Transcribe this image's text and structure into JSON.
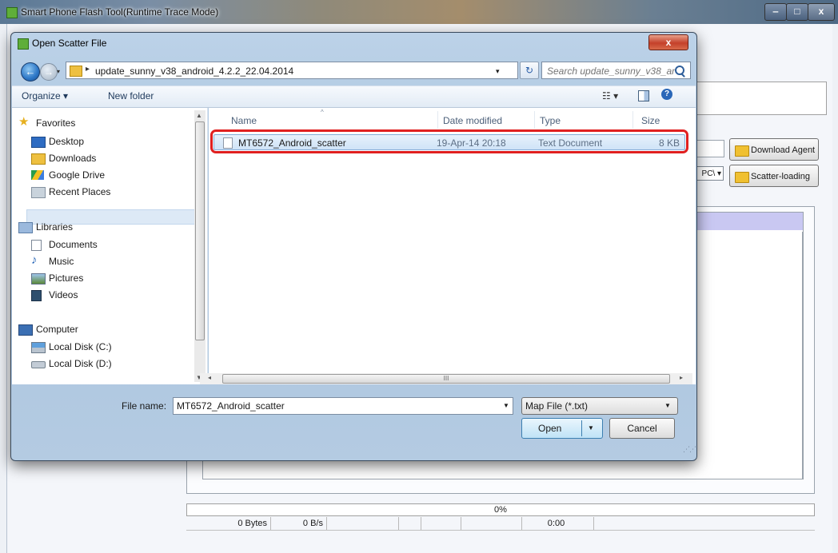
{
  "main_window": {
    "title": "Smart Phone Flash Tool(Runtime Trace Mode)",
    "controls": {
      "minimize": "‒",
      "maximize": "□",
      "close": "x"
    },
    "buttons": {
      "download_agent": "Download Agent",
      "scatter_loading": "Scatter-loading"
    },
    "scatter_combo_value": "PC\\ ▾",
    "status": {
      "percent": "0%",
      "bytes": "0 Bytes",
      "rate": "0 B/s",
      "time": "0:00"
    }
  },
  "dialog": {
    "title": "Open Scatter File",
    "close_label": "x",
    "address": {
      "path": "update_sunny_v38_android_4.2.2_22.04.2014",
      "separator": "▸",
      "dropdown": "▾"
    },
    "search": {
      "placeholder": "Search update_sunny_v38_an..."
    },
    "refresh_label": "↻",
    "toolbar": {
      "organize": "Organize ▾",
      "new_folder": "New folder",
      "views": "☷ ▾",
      "help": "?"
    },
    "nav": {
      "favorites": {
        "heading": "Favorites",
        "items": [
          "Desktop",
          "Downloads",
          "Google Drive",
          "Recent Places"
        ]
      },
      "libraries": {
        "heading": "Libraries",
        "items": [
          "Documents",
          "Music",
          "Pictures",
          "Videos"
        ]
      },
      "computer": {
        "heading": "Computer",
        "items": [
          "Local Disk (C:)",
          "Local Disk (D:)"
        ]
      }
    },
    "columns": {
      "name": "Name",
      "date": "Date modified",
      "type": "Type",
      "size": "Size"
    },
    "files": [
      {
        "name": "MT6572_Android_scatter",
        "date": "19-Apr-14 20:18",
        "type": "Text Document",
        "size": "8 KB"
      }
    ],
    "hscroll_grip": "III",
    "filename": {
      "label": "File name:",
      "value": "MT6572_Android_scatter"
    },
    "filetype": {
      "value": "Map File (*.txt)"
    },
    "buttons": {
      "open": "Open",
      "cancel": "Cancel"
    },
    "colors": {
      "highlight": "#e02020",
      "selection": "#cfe3f7"
    }
  }
}
